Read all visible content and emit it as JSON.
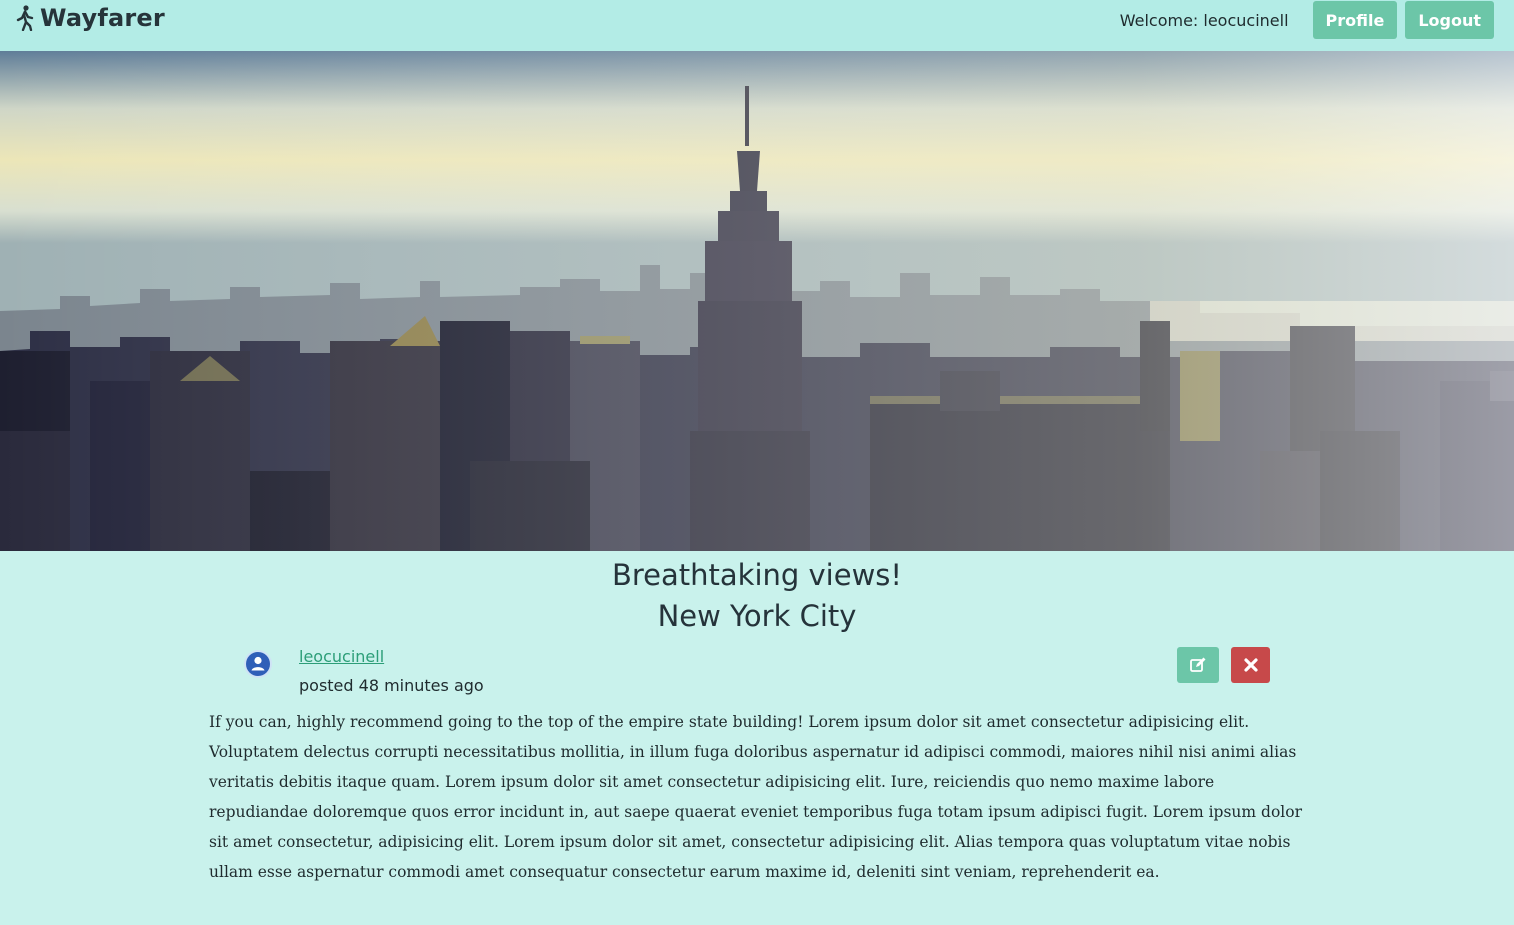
{
  "nav": {
    "brand": "Wayfarer",
    "brand_icon": "walking-person-icon",
    "welcome": "Welcome: leocucinell",
    "profile_label": "Profile",
    "logout_label": "Logout",
    "accent": "#6cc6a8"
  },
  "hero": {
    "image": "new-york-city-skyline-empire-state-building"
  },
  "post": {
    "title": "Breathtaking views!",
    "city": "New York City",
    "author": "leocucinell",
    "posted": "posted 48 minutes ago",
    "edit_icon": "edit-icon",
    "delete_icon": "close-icon",
    "body": "If you can, highly recommend going to the top of the empire state building! Lorem ipsum dolor sit amet consectetur adipisicing elit. Voluptatem delectus corrupti necessitatibus mollitia, in illum fuga doloribus aspernatur id adipisci commodi, maiores nihil nisi animi alias veritatis debitis itaque quam. Lorem ipsum dolor sit amet consectetur adipisicing elit. Iure, reiciendis quo nemo maxime labore repudiandae doloremque quos error incidunt in, aut saepe quaerat eveniet temporibus fuga totam ipsum adipisci fugit. Lorem ipsum dolor sit amet consectetur, adipisicing elit. Lorem ipsum dolor sit amet, consectetur adipisicing elit. Alias tempora quas voluptatum vitae nobis ullam esse aspernatur commodi amet consequatur consectetur earum maxime id, deleniti sint veniam, reprehenderit ea.",
    "delete_color": "#c7494a"
  }
}
